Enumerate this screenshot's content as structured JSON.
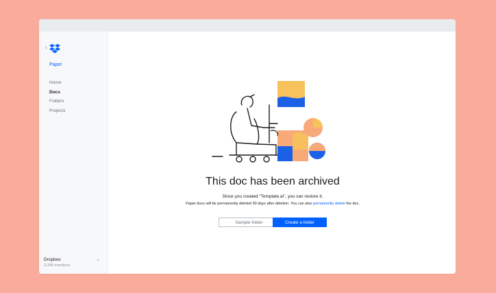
{
  "window": {
    "title": ""
  },
  "sidebar": {
    "back_glyph": "‹",
    "logo_icon": "dropbox-logo-icon",
    "app_name": "Paper",
    "items": [
      {
        "label": "Home",
        "active": false
      },
      {
        "label": "Docs",
        "active": true
      },
      {
        "label": "Folders",
        "active": false
      },
      {
        "label": "Projects",
        "active": false
      }
    ],
    "team": {
      "name": "Dropbox",
      "members": "3,396 members",
      "toggle_glyph": "⌃"
    }
  },
  "main": {
    "illustration_icon": "archived-doc-illustration",
    "title": "This doc has been archived",
    "description_line1": "Since you created \"Template.ai\", you can restore it.",
    "description_line2_prefix": "Paper docs will be permanently deleted 30 days after deletion. You can also ",
    "description_line2_link": "permanently delete",
    "description_line2_suffix": " the doc.",
    "buttons": {
      "sample": "Sample folder",
      "create": "Create a folder"
    }
  },
  "colors": {
    "background": "#f9ac9c",
    "accent": "#0061fe",
    "illustration_orange": "#f7a978",
    "illustration_yellow": "#f7c15c",
    "illustration_blue": "#1b61e8"
  }
}
